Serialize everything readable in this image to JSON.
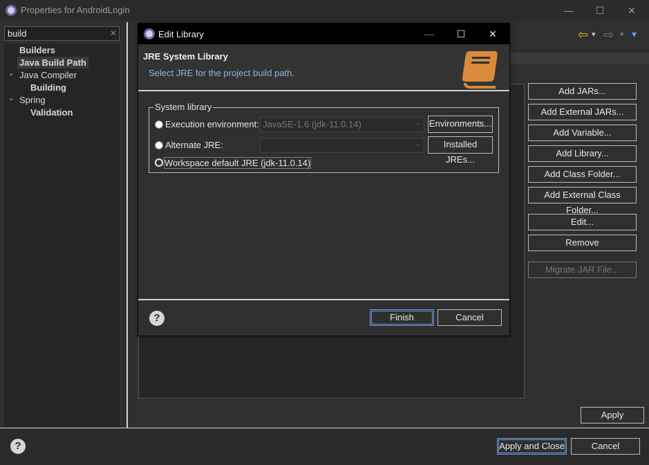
{
  "window": {
    "title": "Properties for AndroidLogin",
    "minimize": "—",
    "maximize": "☐",
    "close": "✕"
  },
  "filter": {
    "value": "build",
    "clear": "✕"
  },
  "tree": {
    "builders": "Builders",
    "java_build_path": "Java Build Path",
    "java_compiler": "Java Compiler",
    "building": "Building",
    "spring": "Spring",
    "validation": "Validation",
    "chevron": "⌄"
  },
  "nav": {
    "back": "⇦",
    "forward": "⇨",
    "menu": "▾"
  },
  "buttons": {
    "add_jars": "Add JARs...",
    "add_external_jars": "Add External JARs...",
    "add_variable": "Add Variable...",
    "add_library": "Add Library...",
    "add_class_folder": "Add Class Folder...",
    "add_external_class_folder": "Add External Class Folder...",
    "edit": "Edit...",
    "remove": "Remove",
    "migrate_jar": "Migrate JAR File...",
    "apply": "Apply",
    "apply_and_close": "Apply and Close",
    "cancel": "Cancel"
  },
  "dialog": {
    "title": "Edit Library",
    "heading": "JRE System Library",
    "subtitle": "Select JRE for the project build path.",
    "group_label": "System library",
    "execution_env_label": "Execution environment:",
    "execution_env_value": "JavaSE-1.6 (jdk-11.0.14)",
    "alternate_jre_label": "Alternate JRE:",
    "alternate_jre_value": "",
    "workspace_default": "Workspace default JRE (jdk-11.0.14)",
    "environments_button": "Environments...",
    "installed_jres_button": "Installed JREs...",
    "finish": "Finish",
    "cancel": "Cancel",
    "help": "?"
  },
  "help": "?",
  "colors": {
    "accent": "#6ea0e0",
    "book_icon": "#d98a3a",
    "nav_back": "#f2b705"
  }
}
